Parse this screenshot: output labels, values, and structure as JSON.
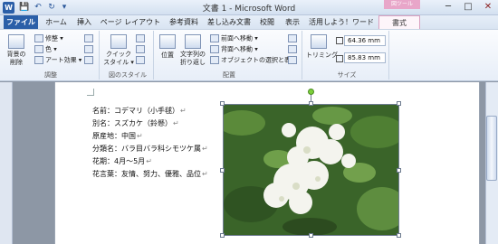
{
  "window": {
    "title": "文書 1 - Microsoft Word",
    "context_tab_header": "図ツール",
    "qat": {
      "logo": "W",
      "save": "💾",
      "undo": "↶",
      "redo": "↻",
      "customize": "▾"
    },
    "controls": {
      "minimize": "─",
      "maximize": "□",
      "close": "✕"
    }
  },
  "tabs": [
    "ファイル",
    "ホーム",
    "挿入",
    "ページ レイアウト",
    "参考資料",
    "差し込み文書",
    "校閲",
    "表示",
    "活用しよう！ワード",
    "書式"
  ],
  "ribbon": {
    "groups": {
      "adjust": "調整",
      "styles": "図のスタイル",
      "arrange": "配置",
      "size": "サイズ"
    },
    "remove_bg": "背景の\n削除",
    "correction": "修整 ▾",
    "color": "色 ▾",
    "art_effects": "アート効果 ▾",
    "quick_styles": "クイック\nスタイル ▾",
    "position": "位置",
    "wrap_text": "文字列の\n折り返し",
    "bring_forward": "前面へ移動 ▾",
    "send_backward": "背面へ移動 ▾",
    "selection_pane": "オブジェクトの選択と表示",
    "crop": "トリミング",
    "height": "64.36 mm",
    "width": "85.83 mm"
  },
  "document": {
    "lines": [
      "名前：コデマリ（小手毬）",
      "別名：スズカケ（鈴懸）",
      "原産地：中国",
      "分類名：バラ目バラ科シモツケ属",
      "花期：4月～5月",
      "花言葉：友情、努力、優雅、品位"
    ],
    "para_mark": "↵"
  },
  "colors": {
    "file_tab": "#2a5fa8",
    "context_tab": "#e8a6c9",
    "ribbon_bg": "#eef3fa",
    "photo_leaf": "#3f6a2e",
    "flower": "#f4f4ee"
  }
}
